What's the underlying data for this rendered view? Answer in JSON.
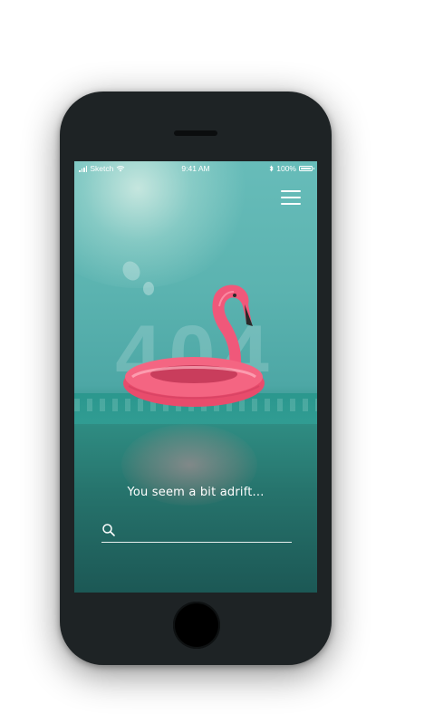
{
  "status_bar": {
    "carrier": "Sketch",
    "time": "9:41 AM",
    "bluetooth_icon": "bluetooth-icon",
    "battery": "100%"
  },
  "header": {
    "menu_icon": "hamburger-menu-icon"
  },
  "hero": {
    "error_code": "404"
  },
  "message": {
    "text": "You seem a bit adrift..."
  },
  "search": {
    "icon": "search-icon",
    "value": "",
    "placeholder": ""
  },
  "colors": {
    "device_shell": "#1e2325",
    "sky": "#5bb3b0",
    "water": "#2c8b83",
    "flamingo_pink": "#f0587a",
    "text": "#ffffff"
  }
}
